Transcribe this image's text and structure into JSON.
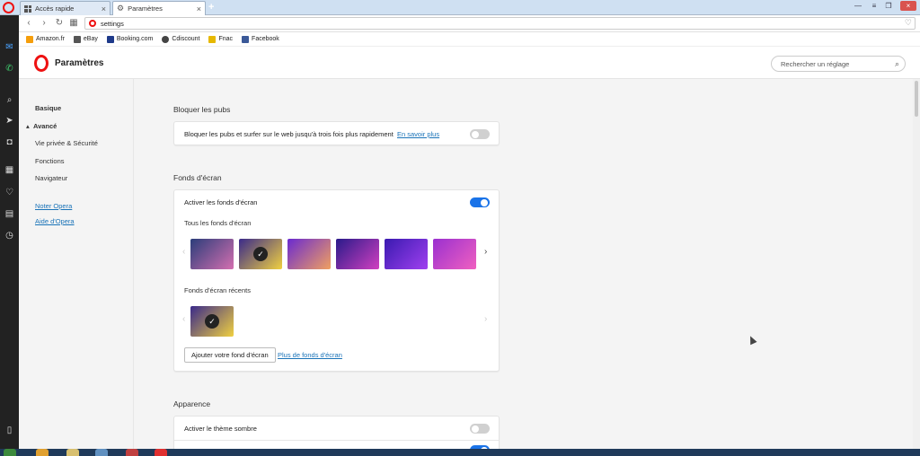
{
  "tabs": [
    {
      "label": "Accès rapide",
      "icon": "grid-icon",
      "active": false
    },
    {
      "label": "Paramètres",
      "icon": "gear-icon",
      "active": true
    }
  ],
  "window_controls": [
    "minimize",
    "restore",
    "close"
  ],
  "address": {
    "value": "settings"
  },
  "bookmarks": [
    {
      "label": "Amazon.fr",
      "color": "#f59e0b"
    },
    {
      "label": "eBay",
      "color": "#555555"
    },
    {
      "label": "Booking.com",
      "color": "#1e3a8a"
    },
    {
      "label": "Cdiscount",
      "color": "#444444"
    },
    {
      "label": "Fnac",
      "color": "#e6b800"
    },
    {
      "label": "Facebook",
      "color": "#3b5998"
    }
  ],
  "header": {
    "title": "Paramètres",
    "search_placeholder": "Rechercher un réglage"
  },
  "menu": {
    "basic": "Basique",
    "advanced": "Avancé",
    "items": [
      "Vie privée & Sécurité",
      "Fonctions",
      "Navigateur"
    ],
    "links": [
      "Noter Opera",
      "Aide d'Opera"
    ]
  },
  "ads": {
    "section_title": "Bloquer les pubs",
    "row_text": "Bloquer les pubs et surfer sur le web jusqu'à trois fois plus rapidement",
    "learn_more": "En savoir plus",
    "enabled": false
  },
  "wallpapers": {
    "section_title": "Fonds d'écran",
    "enable_label": "Activer les fonds d'écran",
    "enabled": true,
    "all_label": "Tous les fonds d'écran",
    "recent_label": "Fonds d'écran récents",
    "add_button": "Ajouter votre fond d'écran",
    "more_link": "Plus de fonds d'écran",
    "all_thumbs": [
      {
        "from": "#2b3d7a",
        "to": "#d46fb0",
        "selected": false
      },
      {
        "from": "#3a2a8a",
        "to": "#f0d040",
        "selected": true
      },
      {
        "from": "#6a2ad0",
        "to": "#f0a060",
        "selected": false
      },
      {
        "from": "#2a1a8a",
        "to": "#d040c0",
        "selected": false
      },
      {
        "from": "#3a1ab0",
        "to": "#a040f0",
        "selected": false
      },
      {
        "from": "#9a30d0",
        "to": "#f060c0",
        "selected": false
      }
    ],
    "recent_thumbs": [
      {
        "from": "#3a2a8a",
        "to": "#f0d040",
        "selected": true
      }
    ]
  },
  "appearance": {
    "section_title": "Apparence",
    "dark_theme_label": "Activer le thème sombre",
    "dark_enabled": false
  },
  "accent_color": "#1a73e8"
}
